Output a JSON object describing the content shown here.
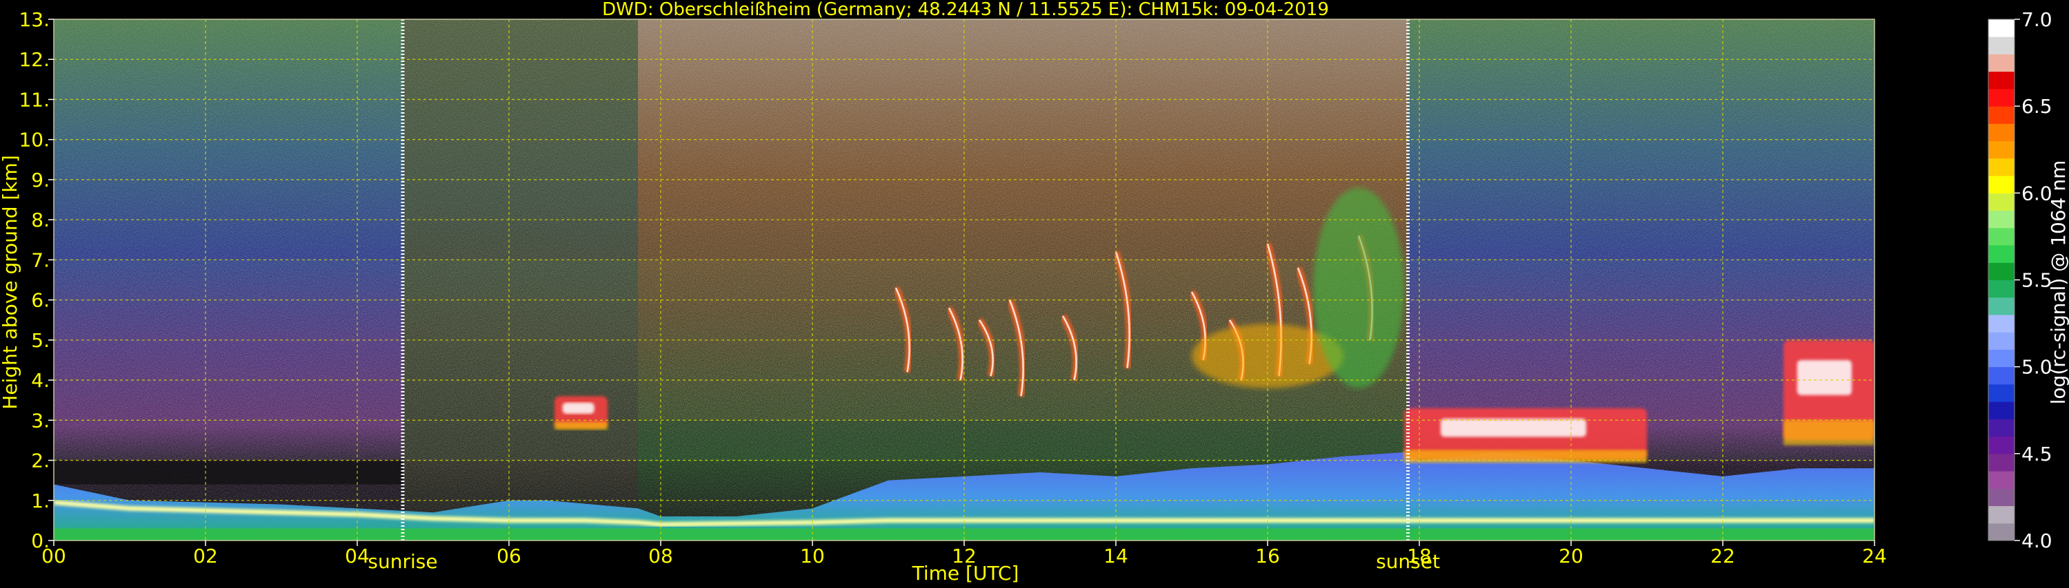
{
  "chart_data": {
    "type": "heatmap",
    "title": "DWD: Oberschleißheim (Germany; 48.2443 N / 11.5525 E):    CHM15k: 09-04-2019",
    "xlabel": "Time [UTC]",
    "ylabel": "Height above ground [km]",
    "xlim": [
      0,
      24
    ],
    "ylim": [
      0,
      13
    ],
    "x_ticks": [
      "00",
      "02",
      "04",
      "06",
      "08",
      "10",
      "12",
      "14",
      "16",
      "18",
      "20",
      "22",
      "24"
    ],
    "y_ticks": [
      "0.",
      "1.",
      "2.",
      "3.",
      "4.",
      "5.",
      "6.",
      "7.",
      "8.",
      "9.",
      "10.",
      "11.",
      "12.",
      "13."
    ],
    "grid": true,
    "markers": [
      {
        "label": "sunrise",
        "time": 4.6
      },
      {
        "label": "sunset",
        "time": 17.85
      }
    ],
    "colorbar": {
      "label": "log(rc-signal) @ 1064 nm",
      "range": [
        4.0,
        7.0
      ],
      "ticks": [
        "4.0",
        "4.5",
        "5.0",
        "5.5",
        "6.0",
        "6.5",
        "7.0"
      ],
      "colors": [
        "#9a8fa0",
        "#b8b0bc",
        "#8a5a96",
        "#9e4ca0",
        "#7a2a90",
        "#6a1aa0",
        "#4a1aa8",
        "#1a1ab0",
        "#1a40d8",
        "#4060f0",
        "#6a8cff",
        "#8fa8ff",
        "#a8bcff",
        "#50c0a0",
        "#20b060",
        "#10a030",
        "#30d050",
        "#60e060",
        "#a0f080",
        "#d0f040",
        "#ffff00",
        "#ffd000",
        "#ffa000",
        "#ff8000",
        "#ff4000",
        "#ff1010",
        "#e00000",
        "#f0b0a0",
        "#d8d8d8",
        "#ffffff"
      ]
    },
    "features": [
      {
        "name": "boundary layer",
        "t": [
          0,
          24
        ],
        "h": [
          0.3,
          2.0
        ]
      },
      {
        "name": "cloud",
        "t": [
          6.6,
          7.3
        ],
        "h": [
          2.8,
          3.6
        ]
      },
      {
        "name": "cirrus",
        "t": [
          10.9,
          17.8
        ],
        "h": [
          3.5,
          7.7
        ]
      },
      {
        "name": "cloud",
        "t": [
          17.8,
          21.0
        ],
        "h": [
          2.0,
          3.3
        ]
      },
      {
        "name": "cloud",
        "t": [
          22.8,
          24.0
        ],
        "h": [
          2.5,
          5.0
        ]
      }
    ]
  }
}
